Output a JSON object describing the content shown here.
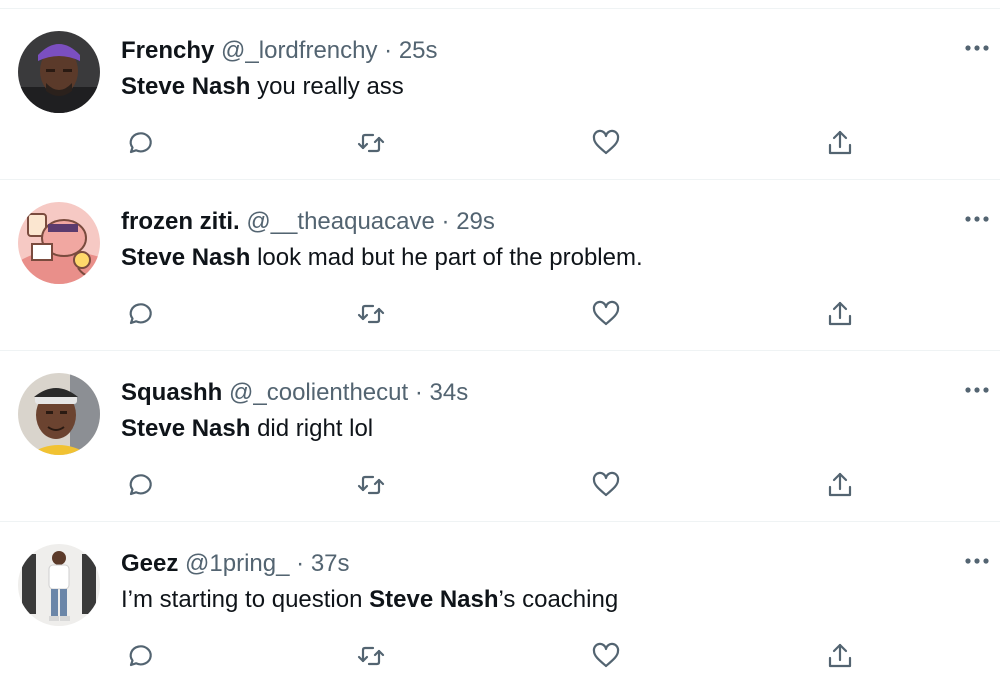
{
  "colors": {
    "text": "#0f1419",
    "secondary": "#536471",
    "divider": "#eff3f4"
  },
  "tweets": [
    {
      "avatar_icon": "user-avatar-purple-cap",
      "name": "Frenchy",
      "handle": "@_lordfrenchy",
      "separator": "·",
      "time": "25s",
      "pre_text": "",
      "mention": "Steve Nash",
      "post_text": " you really ass"
    },
    {
      "avatar_icon": "user-avatar-cartoon",
      "name": "frozen ziti.",
      "handle": "@__theaquacave",
      "separator": "·",
      "time": "29s",
      "pre_text": "",
      "mention": "Steve Nash",
      "post_text": " look mad but he part of the problem."
    },
    {
      "avatar_icon": "user-avatar-headband",
      "name": "Squashh",
      "handle": "@_coolienthecut",
      "separator": "·",
      "time": "34s",
      "pre_text": "",
      "mention": "Steve Nash",
      "post_text": " did right lol"
    },
    {
      "avatar_icon": "user-avatar-standing",
      "name": "Geez",
      "handle": "@1pring_",
      "separator": "·",
      "time": "37s",
      "pre_text": "I’m starting to question ",
      "mention": "Steve Nash",
      "post_text": "’s coaching"
    }
  ]
}
